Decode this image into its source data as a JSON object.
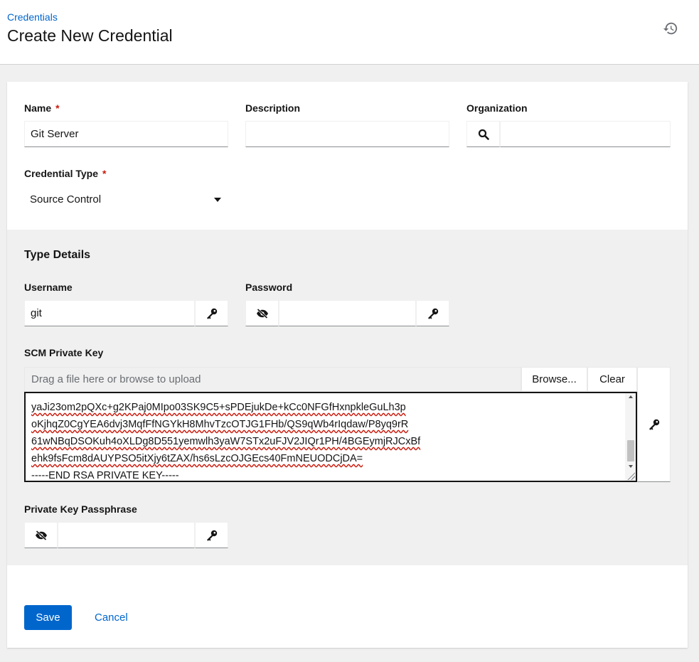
{
  "header": {
    "breadcrumb": "Credentials",
    "title": "Create New Credential",
    "history_icon": "history-icon"
  },
  "form": {
    "name_label": "Name",
    "name_value": "Git Server",
    "required_mark": "*",
    "description_label": "Description",
    "description_value": "",
    "organization_label": "Organization",
    "organization_value": "",
    "credential_type_label": "Credential Type",
    "credential_type_value": "Source Control"
  },
  "type_details": {
    "title": "Type Details",
    "username_label": "Username",
    "username_value": "git",
    "password_label": "Password",
    "password_value": "",
    "scm_key_label": "SCM Private Key",
    "upload_placeholder": "Drag a file here or browse to upload",
    "browse_label": "Browse...",
    "clear_label": "Clear",
    "key_lines": [
      "yaJi23om2pQXc+g2KPaj0MIpo03SK9C5+sPDEjukDe+kCc0NFGfHxnpkleGuLh3p",
      "oKjhqZ0CgYEA6dvj3MqfFfNGYkH8MhvTzcOTJG1FHb/QS9qWb4rIqdaw/P8yq9rR",
      "61wNBqDSOKuh4oXLDg8D551yemwlh3yaW7STx2uFJV2JIQr1PH/4BGEymjRJCxBf",
      "ehk9fsFcm8dAUYPSO5itXjy6tZAX/hs6sLzcOJGEcs40FmNEUODCjDA=",
      "-----END RSA PRIVATE KEY-----"
    ],
    "passphrase_label": "Private Key Passphrase",
    "passphrase_value": ""
  },
  "actions": {
    "save_label": "Save",
    "cancel_label": "Cancel"
  },
  "colors": {
    "accent": "#0066cc",
    "required": "#c9190b",
    "spellcheck": "#c9190b"
  }
}
